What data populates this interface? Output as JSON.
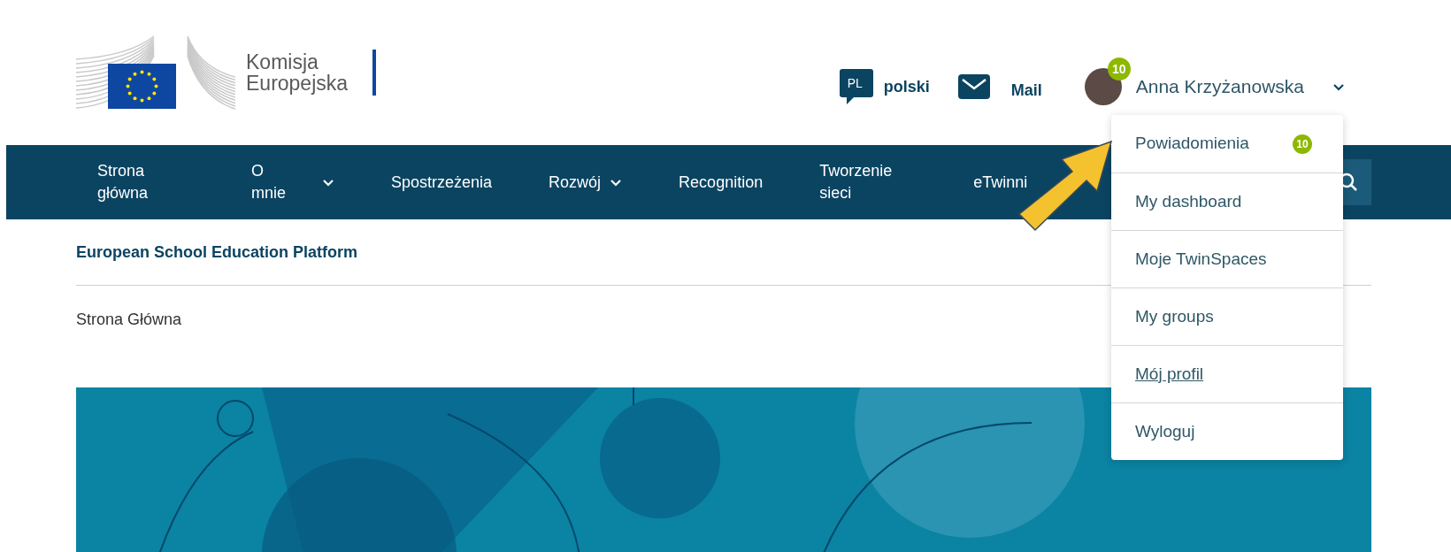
{
  "header": {
    "logo_lines": [
      "Komisja",
      "Europejska"
    ],
    "language": {
      "code": "PL",
      "label": "polski"
    },
    "mail": {
      "label": "Mail"
    },
    "user": {
      "name": "Anna Krzyżanowska",
      "badge": "10"
    }
  },
  "nav": {
    "items": [
      {
        "label": "Strona główna",
        "has_dropdown": false
      },
      {
        "label": "O mnie",
        "has_dropdown": true
      },
      {
        "label": "Spostrzeżenia",
        "has_dropdown": false
      },
      {
        "label": "Rozwój",
        "has_dropdown": true
      },
      {
        "label": "Recognition",
        "has_dropdown": false
      },
      {
        "label": "Tworzenie sieci",
        "has_dropdown": false
      },
      {
        "label": "eTwinni",
        "has_dropdown": false
      }
    ]
  },
  "site_title": "European School Education Platform",
  "breadcrumb": "Strona Główna",
  "user_menu": {
    "items": [
      {
        "label": "Powiadomienia",
        "badge": "10",
        "hovered": false
      },
      {
        "label": "My dashboard",
        "hovered": false
      },
      {
        "label": "Moje TwinSpaces",
        "hovered": false
      },
      {
        "label": "My groups",
        "hovered": false
      },
      {
        "label": "Mój profil",
        "hovered": true
      },
      {
        "label": "Wyloguj",
        "hovered": false
      }
    ]
  }
}
